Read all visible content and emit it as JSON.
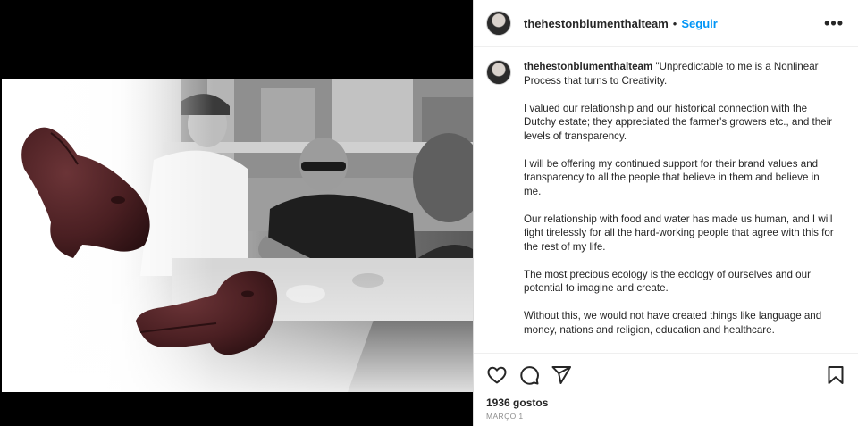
{
  "post": {
    "username": "thehestonblumenthalteam",
    "separator": "•",
    "follow_label": "Seguir",
    "more_label": "•••",
    "caption_lead": "\"Unpredictable to me is a Nonlinear Process that turns to Creativity.",
    "caption_paragraphs": [
      "I valued our relationship and our historical connection with the Dutchy estate; they appreciated the farmer's growers etc., and their levels of transparency.",
      "I will be offering my continued support for their brand values and transparency to all the people that believe in them and believe in me.",
      "Our relationship with food and water has made us human, and I will fight tirelessly for all the hard-working people that agree with this for the rest of my life.",
      "The most precious ecology is the ecology of ourselves and our potential to imagine and create.",
      "Without this, we would not have created things like language and money, nations and religion, education and healthcare."
    ],
    "likes": "1936 gostos",
    "date": "MARÇO 1"
  },
  "icons": {
    "like": "heart-icon",
    "comment": "comment-icon",
    "share": "share-icon",
    "save": "bookmark-icon",
    "more": "more-icon"
  },
  "colors": {
    "accent": "#0095f6",
    "text": "#262626",
    "muted": "#8e8e8e",
    "chocolate": "#4a1f22"
  }
}
